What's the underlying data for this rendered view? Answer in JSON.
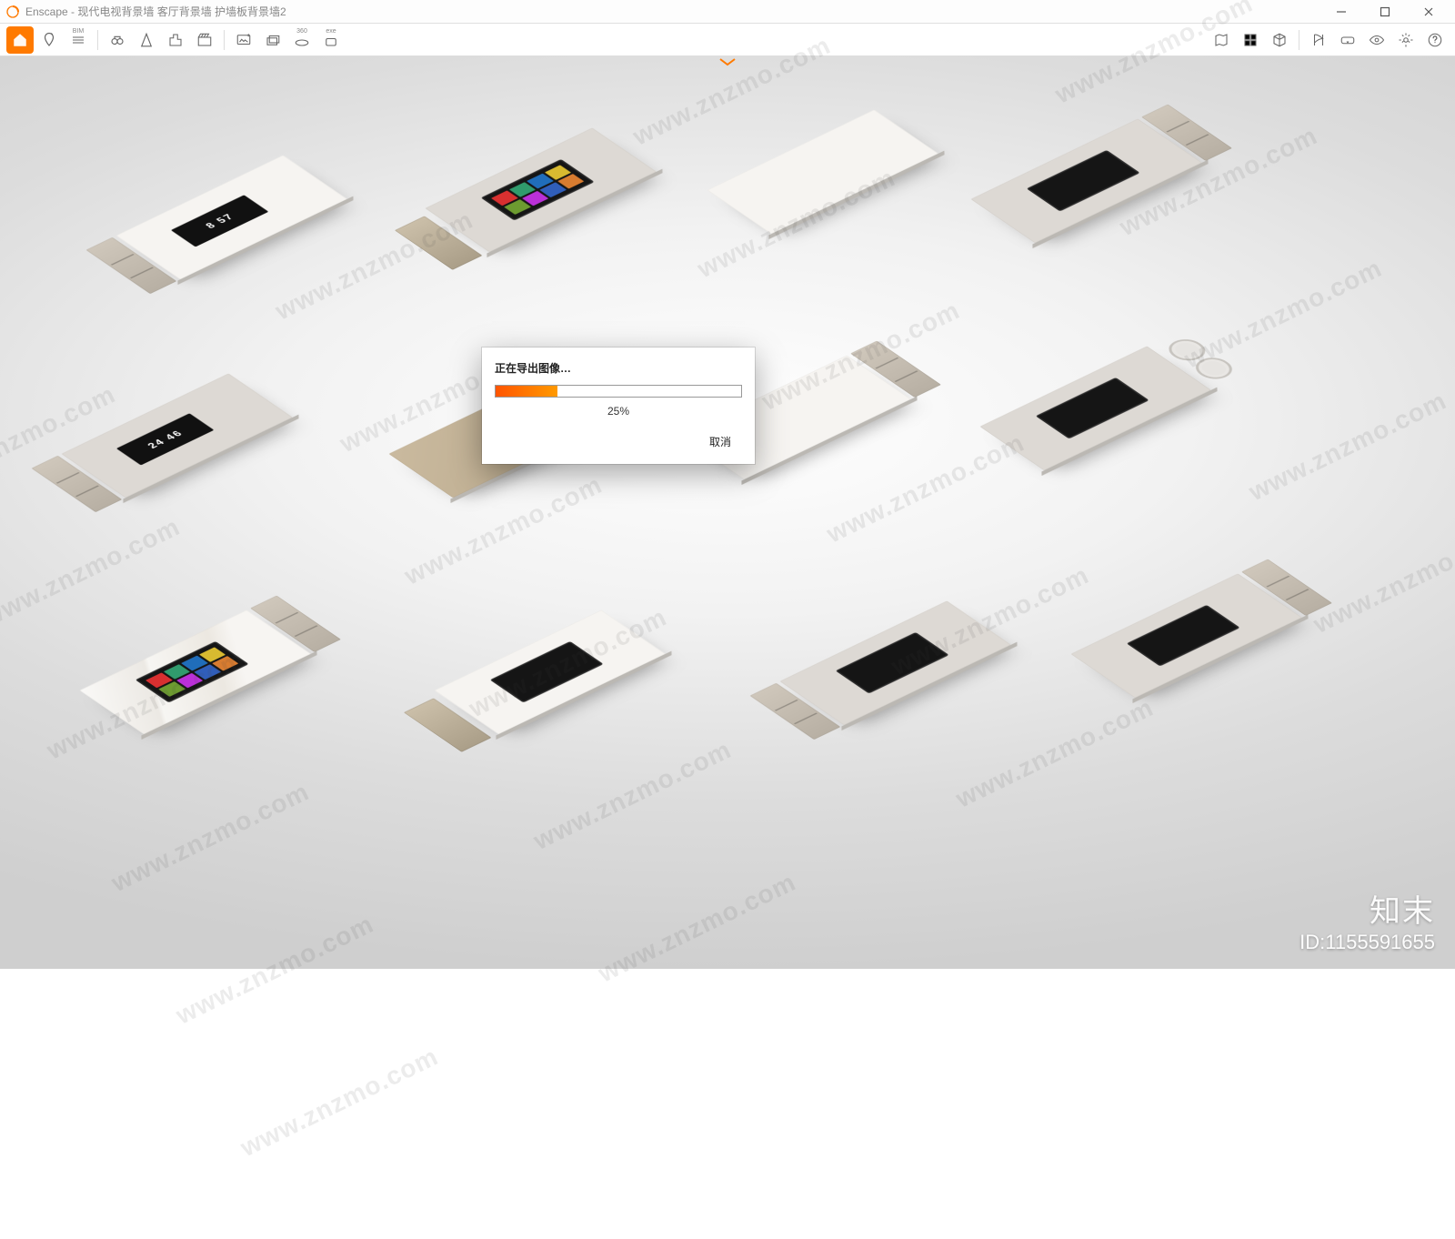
{
  "app": {
    "name": "Enscape"
  },
  "titlebar": {
    "title": "Enscape - 现代电视背景墙 客厅背景墙 护墙板背景墙2"
  },
  "toolbar": {
    "left_icons": [
      "home-icon",
      "pin-icon",
      "bim-icon",
      "binoculars-icon",
      "compass-icon",
      "building-icon",
      "clapper-icon"
    ],
    "mid_icons": [
      "image-up-icon",
      "image-layers-icon",
      "pano360-icon",
      "exe-export-icon"
    ],
    "right_icons": [
      "map-icon",
      "materials-icon",
      "cube-icon",
      "path-icon",
      "vr-icon",
      "eye-icon",
      "settings-icon",
      "help-icon"
    ],
    "bim_label": "BIM",
    "pano_label": "360",
    "exe_label": "exe"
  },
  "dialog": {
    "title": "正在导出图像…",
    "percent_label": "25%",
    "percent_value": 25,
    "cancel": "取消"
  },
  "scene": {
    "clock1": "8 57",
    "clock2": "24 46"
  },
  "watermark": {
    "text": "www.znzmo.com",
    "brand": "知末",
    "id_label": "ID:1155591655"
  },
  "colors": {
    "accent": "#ff7a00",
    "progress_start": "#ff5400",
    "progress_end": "#ff9a00"
  }
}
